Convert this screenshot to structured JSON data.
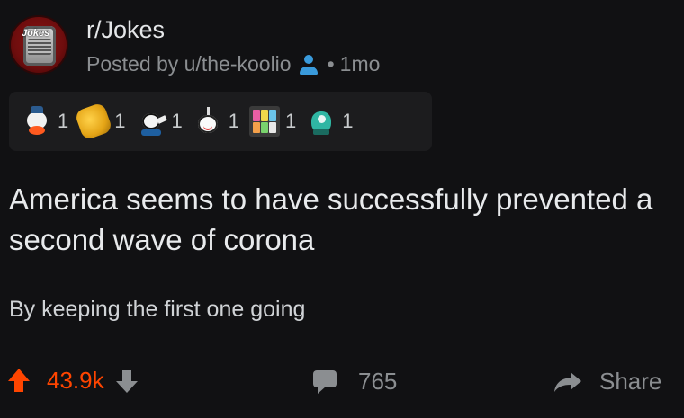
{
  "subreddit": {
    "name": "r/Jokes",
    "avatar_icon": "jokes-microphone-logo",
    "logo_text": "Jokes"
  },
  "post_meta": {
    "posted_by": "Posted by u/the-koolio",
    "user_icon": "user-icon",
    "age": "1mo"
  },
  "awards": [
    {
      "icon": "silver-award-icon",
      "count": "1"
    },
    {
      "icon": "fist-award-icon",
      "count": "1"
    },
    {
      "icon": "snoo-award-icon",
      "count": "1"
    },
    {
      "icon": "wholesome-award-icon",
      "count": "1"
    },
    {
      "icon": "grid-award-icon",
      "count": "1"
    },
    {
      "icon": "helpful-award-icon",
      "count": "1"
    }
  ],
  "post": {
    "title": "America seems to have successfully prevented a second wave of corona",
    "body": "By keeping the first one going"
  },
  "actions": {
    "score": "43.9k",
    "comments": "765",
    "share_label": "Share"
  },
  "colors": {
    "background": "#111113",
    "upvote": "#ff4500",
    "muted": "#8b8e91",
    "user_icon": "#3a9bdc"
  }
}
